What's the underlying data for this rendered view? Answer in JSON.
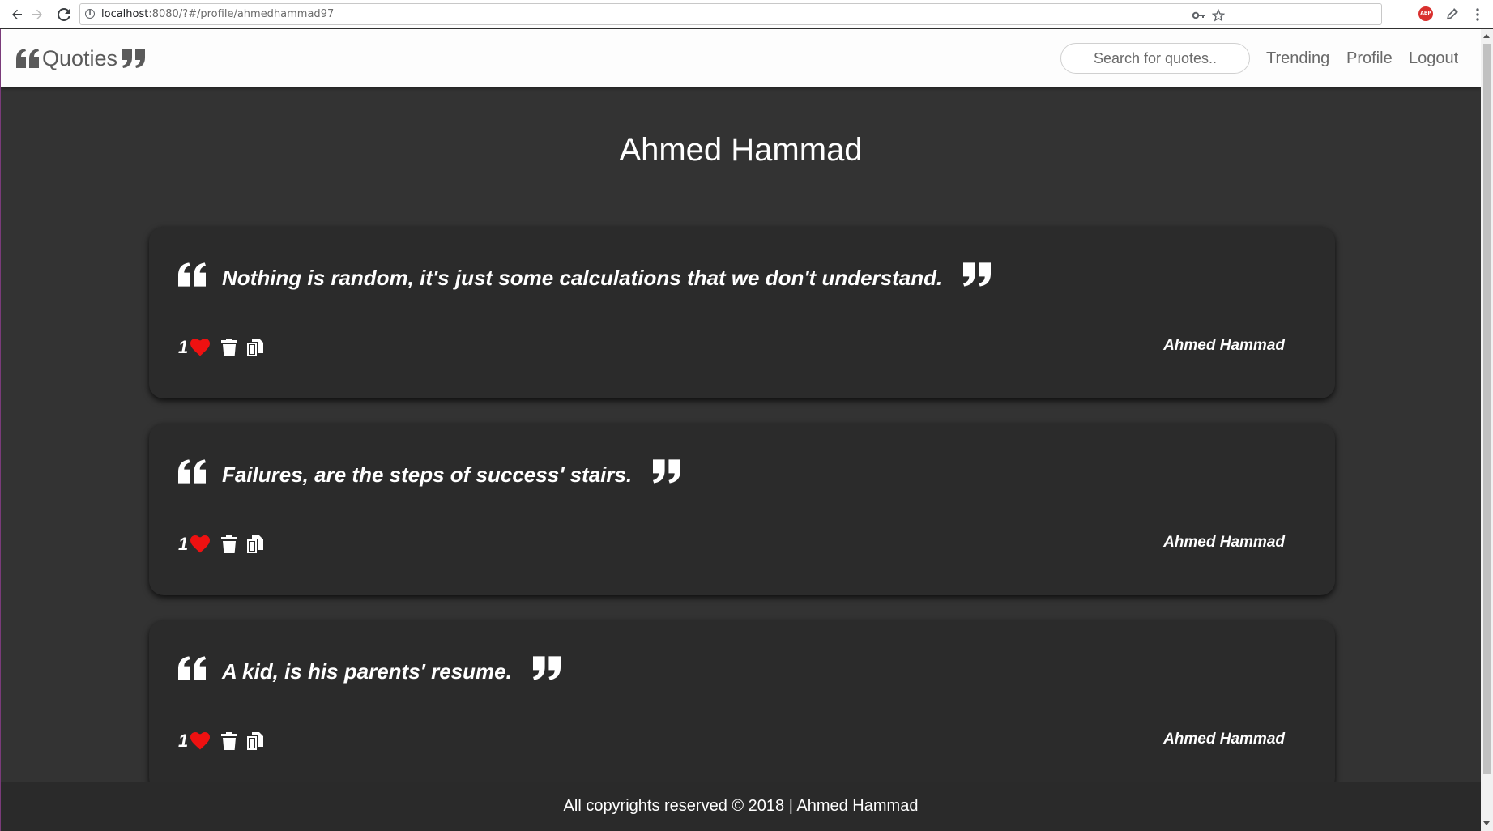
{
  "browser": {
    "url_host": "localhost",
    "url_rest": ":8080/?#/profile/ahmedhammad97",
    "icons": [
      "back-arrow-icon",
      "forward-arrow-icon",
      "reload-icon",
      "info-icon",
      "key-icon",
      "star-icon",
      "adblock-plus-icon",
      "eyedropper-icon",
      "more-menu-icon"
    ],
    "abp_label": "ABP"
  },
  "navbar": {
    "brand": "Quoties",
    "brand_open_quote": "❝",
    "brand_close_quote": "❞",
    "search_placeholder": "Search for quotes..",
    "links": [
      "Trending",
      "Profile",
      "Logout"
    ]
  },
  "profile": {
    "name": "Ahmed Hammad"
  },
  "quotes": [
    {
      "text": "Nothing is random, it's just some calculations that we don't understand.",
      "author": "Ahmed Hammad",
      "likes": "1"
    },
    {
      "text": "Failures, are the steps of success' stairs.",
      "author": "Ahmed Hammad",
      "likes": "1"
    },
    {
      "text": "A kid, is his parents' resume.",
      "author": "Ahmed Hammad",
      "likes": "1"
    }
  ],
  "footer": {
    "text": "All copyrights reserved © 2018 | Ahmed Hammad"
  },
  "colors": {
    "page_bg": "#333333",
    "card_bg": "#2b2b2b",
    "heart": "#ee1111",
    "navbar_bg": "#fdfdfd",
    "nav_text": "#6a6a6a"
  }
}
